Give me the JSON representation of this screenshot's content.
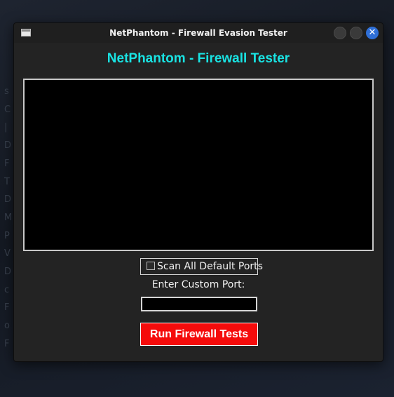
{
  "window": {
    "title": "NetPhantom - Firewall Evasion Tester",
    "close_glyph": "✕"
  },
  "app": {
    "heading": "NetPhantom - Firewall Tester",
    "scan_all_label": "Scan All Default Ports",
    "scan_all_checked": false,
    "custom_port_label": "Enter Custom Port:",
    "custom_port_value": "",
    "run_button_label": "Run Firewall Tests"
  },
  "colors": {
    "heading": "#19e3e3",
    "run_button": "#f50b0b",
    "close_button": "#2f6fd6"
  },
  "icons": {
    "app_icon": "window-icon",
    "close": "close-icon"
  }
}
